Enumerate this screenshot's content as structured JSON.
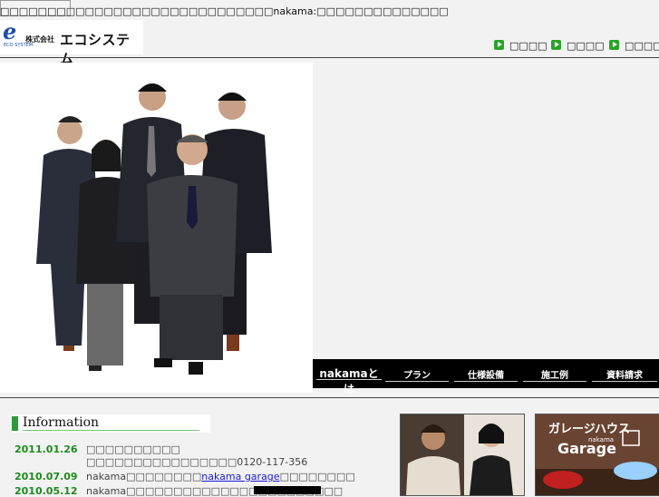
{
  "header": {
    "top_text": "□□□□□□□□□□□□□□□□□□□□□□□□□□□□□nakama:□□□□□□□□□□□□□□",
    "logo": {
      "mark": "e",
      "mark_small": "ECO SYSTEM",
      "kabushiki": "株式会社",
      "company": "エコシステム"
    },
    "links": [
      "□□□□",
      "□□□□",
      "□□□□□□"
    ],
    "link_icon": "green-play-icon",
    "link_color": "#28a428"
  },
  "nav": {
    "items": [
      "nakamaとは",
      "プラン",
      "仕様設備",
      "施工例",
      "資料請求"
    ]
  },
  "info": {
    "heading": "Information",
    "accent": "#2c9a3a",
    "news": [
      {
        "date": "2011.01.26",
        "lines": [
          "□□□□□□□□□□",
          "□□□□□□□□□□□□□□□□0120-117-356"
        ]
      },
      {
        "date": "2010.07.09",
        "pre": "nakama□□□□□□□□",
        "link": "nakama garage",
        "post": "□□□□□□□□"
      },
      {
        "date": "2010.05.12",
        "text": "nakama□□□□□□□□□□□□□□□□□□□□□□□"
      }
    ]
  },
  "banners": {
    "garage_title": "ガレージハウス",
    "garage_brand": "Garage",
    "garage_small": "nakama"
  }
}
